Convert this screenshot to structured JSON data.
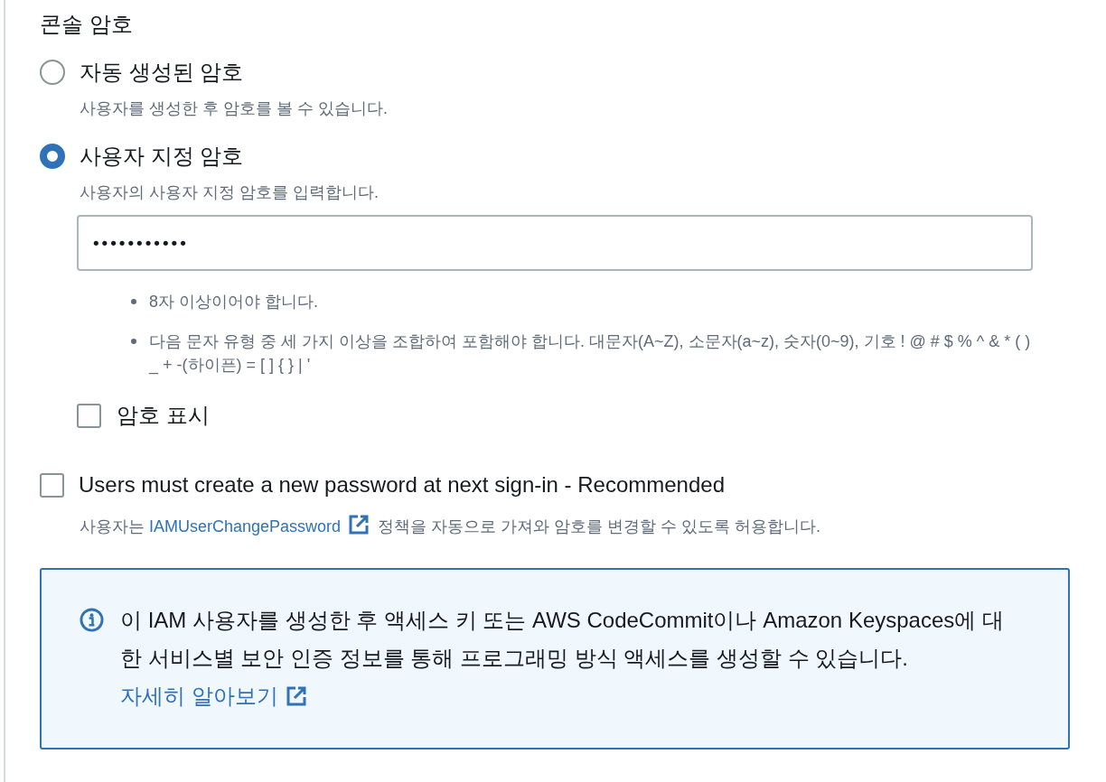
{
  "section": {
    "title": "콘솔 암호"
  },
  "password_options": [
    {
      "label": "자동 생성된 암호",
      "description": "사용자를 생성한 후 암호를 볼 수 있습니다.",
      "selected": false
    },
    {
      "label": "사용자 지정 암호",
      "description": "사용자의 사용자 지정 암호를 입력합니다.",
      "selected": true
    }
  ],
  "password_field": {
    "value": "•••••••••••"
  },
  "requirements": [
    "8자 이상이어야 합니다.",
    "다음 문자 유형 중 세 가지 이상을 조합하여 포함해야 합니다. 대문자(A~Z), 소문자(a~z), 숫자(0~9), 기호 ! @ # $ % ^ & * ( ) _ + -(하이픈) = [ ] { } | '"
  ],
  "show_password": {
    "label": "암호 표시",
    "checked": false
  },
  "require_reset": {
    "label": "Users must create a new password at next sign-in - Recommended",
    "checked": false,
    "description_before": "사용자는 ",
    "description_link": "IAMUserChangePassword",
    "description_after": " 정책을 자동으로 가져와 암호를 변경할 수 있도록 허용합니다."
  },
  "info": {
    "text": "이 IAM 사용자를 생성한 후 액세스 키 또는 AWS CodeCommit이나 Amazon Keyspaces에 대한 서비스별 보안 인증 정보를 통해 프로그래밍 방식 액세스를 생성할 수 있습니다.",
    "link": "자세히 알아보기"
  }
}
